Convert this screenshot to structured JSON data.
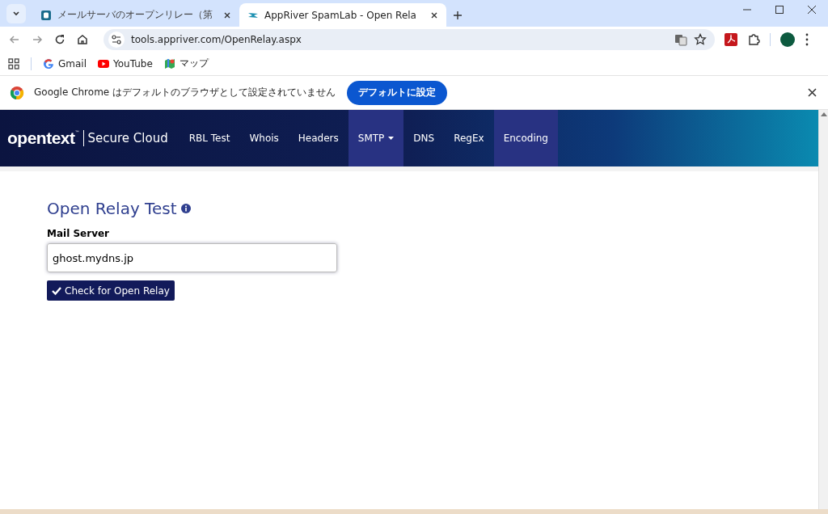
{
  "browser": {
    "tabs": [
      {
        "title": "メールサーバのオープンリレー（第",
        "selected": false
      },
      {
        "title": "AppRiver SpamLab - Open Rela",
        "selected": true
      }
    ],
    "address": "tools.appriver.com/OpenRelay.aspx",
    "bookmarks": [
      {
        "label": "Gmail",
        "kind": "google"
      },
      {
        "label": "YouTube",
        "kind": "play"
      },
      {
        "label": "マップ",
        "kind": "map"
      }
    ]
  },
  "infobar": {
    "message": "Google Chrome はデフォルトのブラウザとして設定されていません",
    "button": "デフォルトに設定"
  },
  "site": {
    "logo": "opentext",
    "logo_mark": "™",
    "product": "Secure Cloud",
    "nav": [
      {
        "label": "RBL Test",
        "selected": false,
        "dropdown": false
      },
      {
        "label": "Whois",
        "selected": false,
        "dropdown": false
      },
      {
        "label": "Headers",
        "selected": false,
        "dropdown": false
      },
      {
        "label": "SMTP",
        "selected": true,
        "dropdown": true
      },
      {
        "label": "DNS",
        "selected": false,
        "dropdown": false
      },
      {
        "label": "RegEx",
        "selected": false,
        "dropdown": false
      },
      {
        "label": "Encoding",
        "selected": true,
        "dropdown": false
      }
    ]
  },
  "form": {
    "title": "Open Relay Test",
    "field_label": "Mail Server",
    "value": "ghost.mydns.jp",
    "button": "Check for Open Relay"
  }
}
